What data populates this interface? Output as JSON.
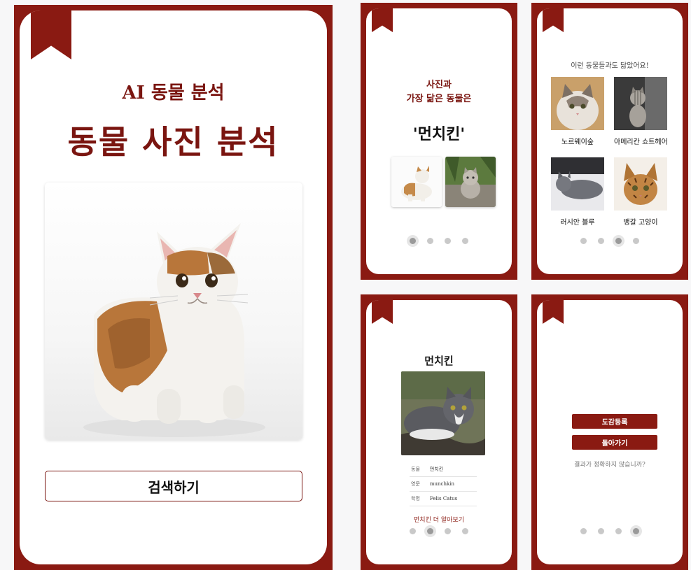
{
  "main": {
    "subtitle": "AI 동물 분석",
    "title": "동물 사진 분석",
    "search_label": "검색하기"
  },
  "result": {
    "line1": "사진과",
    "line2": "가장 닮은 동물은",
    "breed": "'먼치킨'"
  },
  "similar": {
    "heading": "이런 동물들과도 닮았어요!",
    "items": [
      {
        "label": "노르웨이숲"
      },
      {
        "label": "아메리칸 쇼트헤어"
      },
      {
        "label": "러시안 블루"
      },
      {
        "label": "뱅갈 고양이"
      }
    ]
  },
  "detail": {
    "title": "먼치킨",
    "rows": [
      {
        "key": "동물",
        "value": "먼치킨"
      },
      {
        "key": "영문",
        "value": "munchkin"
      },
      {
        "key": "학명",
        "value": "Felis Catus"
      }
    ],
    "more_link": "먼치킨 더 알아보기"
  },
  "actions": {
    "register_label": "도감등록",
    "back_label": "돌아가기",
    "question": "결과가 정확하지 않습니까?"
  },
  "pagination": {
    "total": 4,
    "screens": [
      1,
      3,
      2,
      4
    ]
  },
  "colors": {
    "brand": "#8a1a12",
    "background": "#f7f7f8"
  }
}
